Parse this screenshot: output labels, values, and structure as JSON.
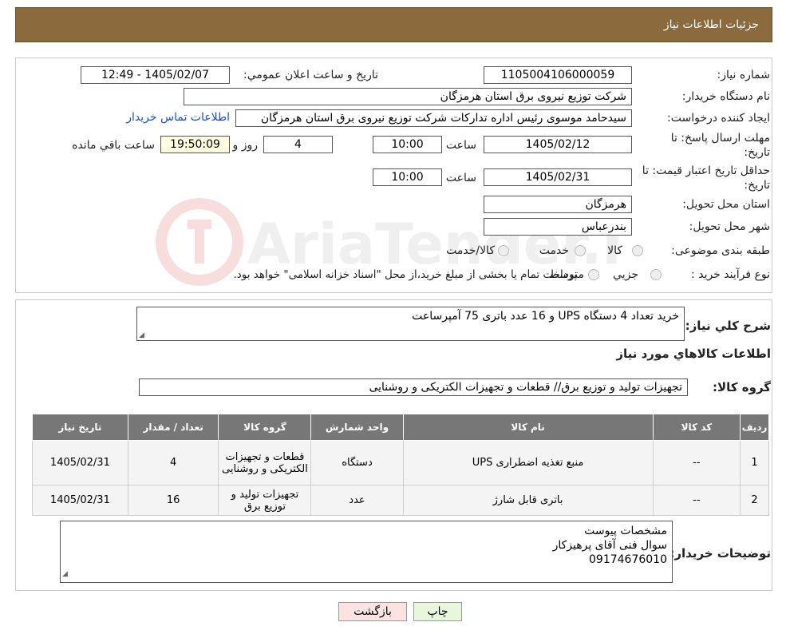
{
  "header": {
    "title": "جزئیات اطلاعات نیاز"
  },
  "fields": {
    "need_number_label": "شماره نیاز:",
    "need_number": "1105004106000059",
    "announce_label": "تاریخ و ساعت اعلان عمومي:",
    "announce_value": "1405/02/07 - 12:49",
    "buyer_org_label": "نام دستگاه خريدار:",
    "buyer_org": "شرکت توزیع نیروی برق استان هرمزگان",
    "requester_label": "ايجاد کننده درخواست:",
    "requester": "سیدحامد موسوی رئیس اداره تدارکات شرکت توزیع نیروی برق استان هرمزگان",
    "contact_link": "اطلاعات تماس خريدار",
    "deadline_label_1": "مهلت ارسال پاسخ: تا",
    "deadline_label_2": "تاريخ:",
    "deadline_date": "1405/02/12",
    "time_label": "ساعت",
    "deadline_time": "10:00",
    "days_value": "4",
    "days_label": "روز و",
    "remaining_time": "19:50:09",
    "remaining_label": "ساعت باقي مانده",
    "validity_label_1": "حداقل تاريخ اعتبار قيمت: تا",
    "validity_label_2": "تاريخ:",
    "validity_date": "1405/02/31",
    "validity_time": "10:00",
    "province_label": "استان محل تحويل:",
    "province": "هرمزگان",
    "city_label": "شهر محل تحويل:",
    "city": "بندرعباس",
    "category_label": "طبقه بندی موضوعی:",
    "category_options": [
      "کالا",
      "خدمت",
      "کالا/خدمت"
    ],
    "process_label": "نوع فرآيند خريد :",
    "process_options": [
      "جزيي",
      "متوسط"
    ],
    "process_note": "پرداخت تمام يا بخشی از مبلغ خريد،از محل \"اسناد خزانه اسلامی\" خواهد بود."
  },
  "description": {
    "label": "شرح کلي نياز:",
    "text": "خرید تعداد 4 دستگاه UPS و 16 عدد باتری 75 آمپرساعت"
  },
  "goods_info_title": "اطلاعات کالاهاي مورد نياز",
  "goods_group": {
    "label": "گروه کالا:",
    "value": "تجهیزات تولید و توزیع برق// قطعات و تجهیزات الکتریکی و روشنایی"
  },
  "table": {
    "headers": [
      "رديف",
      "کد کالا",
      "نام کالا",
      "واحد شمارش",
      "گروه کالا",
      "تعداد / مقدار",
      "تاريخ نياز"
    ],
    "rows": [
      [
        "1",
        "--",
        "منبع تغذیه اضطراری UPS",
        "دستگاه",
        "قطعات و تجهیزات الکتریکی و روشنایی",
        "4",
        "1405/02/31"
      ],
      [
        "2",
        "--",
        "باتری قابل شارژ",
        "عدد",
        "تجهیزات تولید و توزیع برق",
        "16",
        "1405/02/31"
      ]
    ]
  },
  "buyer_notes": {
    "label": "توضيحات خريدار:",
    "lines": [
      "مشخصات پیوست",
      "سوال فنی آقای پرهیزکار",
      "09174676010"
    ]
  },
  "buttons": {
    "print": "چاپ",
    "back": "بازگشت"
  },
  "watermark": {
    "text": "AriaTender.neT"
  },
  "colors": {
    "header_bg": "#8b6a3e",
    "table_header_bg": "#777777",
    "remaining_bg": "#fffde0",
    "link": "#1a4fd0",
    "back_btn_bg": "#fbe3e3",
    "print_btn_bg": "#e8f7dc"
  }
}
